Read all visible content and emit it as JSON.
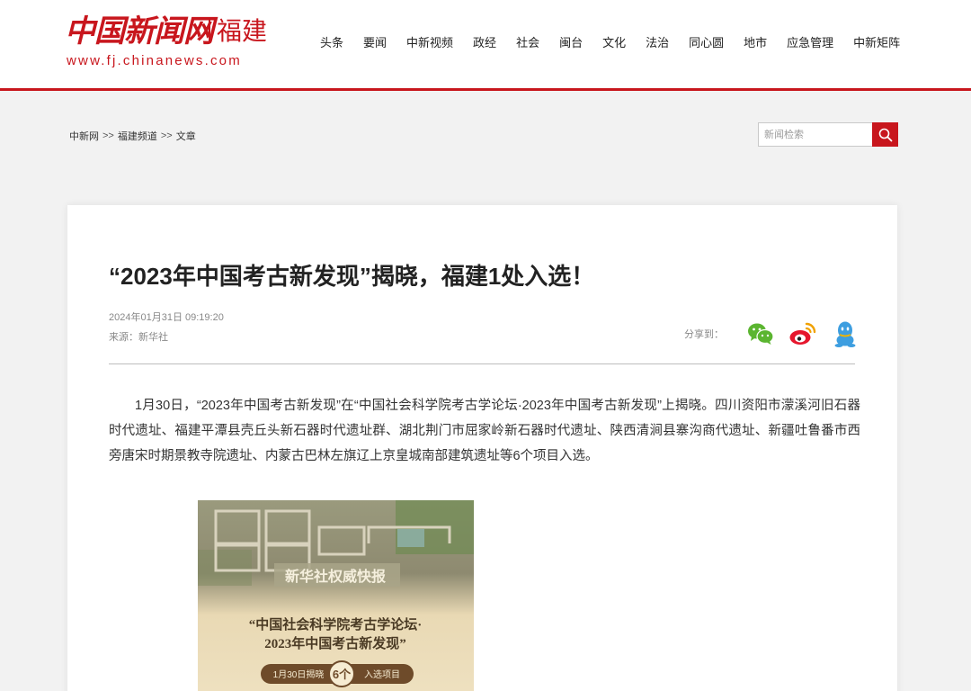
{
  "header": {
    "logo_text": "中国新闻网",
    "region": "福建",
    "url": "www.fj.chinanews.com",
    "nav": [
      "头条",
      "要闻",
      "中新视频",
      "政经",
      "社会",
      "闽台",
      "文化",
      "法治",
      "同心圆",
      "地市",
      "应急管理",
      "中新矩阵"
    ]
  },
  "breadcrumb": {
    "items": [
      "中新网",
      "福建频道",
      "文章"
    ],
    "separator": ">>"
  },
  "search": {
    "placeholder": "新闻检索",
    "icon": "search-icon"
  },
  "article": {
    "title": "“2023年中国考古新发现”揭晓，福建1处入选！",
    "datetime": "2024年01月31日 09:19:20",
    "source": "来源：新华社",
    "share_label": "分享到：",
    "share_icons": [
      "wechat-icon",
      "weibo-icon",
      "qq-icon"
    ],
    "body": "1月30日，“2023年中国考古新发现”在“中国社会科学院考古学论坛·2023年中国考古新发现”上揭晓。四川资阳市濛溪河旧石器时代遗址、福建平潭县壳丘头新石器时代遗址群、湖北荆门市屈家岭新石器时代遗址、陕西清涧县寨沟商代遗址、新疆吐鲁番市西旁唐宋时期景教寺院遗址、内蒙古巴林左旗辽上京皇城南部建筑遗址等6个项目入选。",
    "image": {
      "headline": "新华社权威快报",
      "subtitle_line1": "“中国社会科学院考古学论坛·",
      "subtitle_line2": "2023年中国考古新发现”",
      "badge_left": "1月30日揭晓",
      "badge_number": "6个",
      "badge_right": "入选项目"
    }
  },
  "colors": {
    "brand_red": "#c8161d",
    "background": "#f2f2f2",
    "wechat_green": "#5bb530",
    "weibo_red": "#e6162d",
    "qq_blue": "#3d9ee0"
  }
}
